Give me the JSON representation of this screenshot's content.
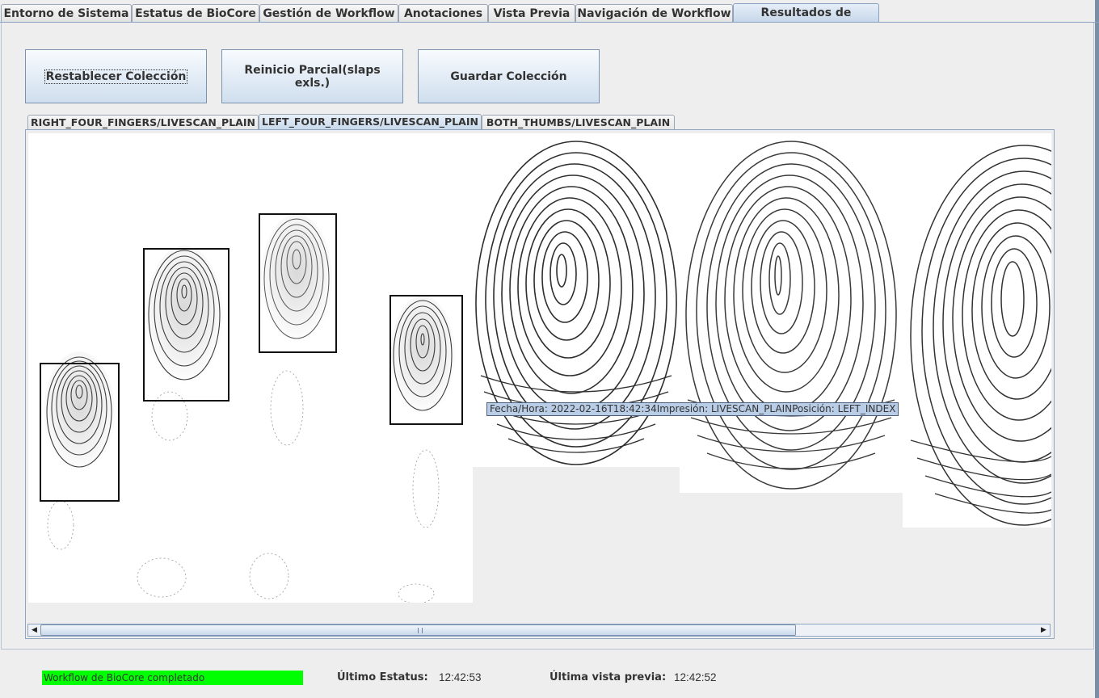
{
  "main_tabs": [
    {
      "label": "Entorno de Sistema",
      "active": false
    },
    {
      "label": "Estatus de BioCore",
      "active": false
    },
    {
      "label": "Gestión de Workflow",
      "active": false
    },
    {
      "label": "Anotaciones",
      "active": false
    },
    {
      "label": "Vista Previa",
      "active": false
    },
    {
      "label": "Navigación de Workflow",
      "active": false
    },
    {
      "label": "Resultados de Captura",
      "active": true
    }
  ],
  "actions": {
    "reset_label": "Restablecer Colección",
    "partial_label": "Reinicio Parcial(slaps exls.)",
    "save_label": "Guardar Colección"
  },
  "capture_tabs": [
    {
      "label": "RIGHT_FOUR_FINGERS/LIVESCAN_PLAIN",
      "active": false
    },
    {
      "label": "LEFT_FOUR_FINGERS/LIVESCAN_PLAIN",
      "active": true
    },
    {
      "label": "BOTH_THUMBS/LIVESCAN_PLAIN",
      "active": false
    }
  ],
  "tooltip": {
    "text": "Fecha/Hora: 2022-02-16T18:42:34Impresión: LIVESCAN_PLAINPosición: LEFT_INDEX"
  },
  "status": {
    "progress_text": "Workflow de BioCore completado",
    "progress_fraction": 1.0,
    "progress_color": "#00ff00",
    "last_status_label": "Último Estatus:",
    "last_status_time": "12:42:53",
    "last_preview_label": "Última vista previa:",
    "last_preview_time": "12:42:52"
  },
  "icons": {
    "scroll_left": "arrow-left-icon",
    "scroll_right": "arrow-right-icon"
  }
}
